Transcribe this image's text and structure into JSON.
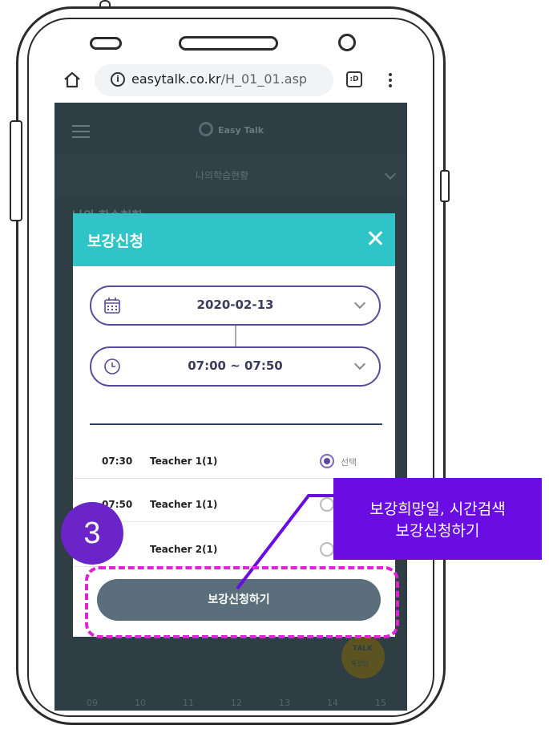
{
  "browser": {
    "url_host": "easytalk.co.kr",
    "url_path": "/H_01_01.asp",
    "tab_icon_label": ":D"
  },
  "web": {
    "logo_text": "Easy Talk",
    "nav_label": "나의학습현황",
    "section_title": "나의 학습현황",
    "talk_label_top": "TALK",
    "talk_label_bottom": "톡상담",
    "hours": [
      "09",
      "10",
      "11",
      "12",
      "13",
      "14",
      "15"
    ]
  },
  "modal": {
    "title": "보강신청",
    "date_value": "2020-02-13",
    "time_value": "07:00 ~ 07:50",
    "rows": [
      {
        "time": "07:30",
        "teacher": "Teacher 1(1)",
        "selected": true,
        "select_label": "선택"
      },
      {
        "time": "07:50",
        "teacher": "Teacher 1(1)",
        "selected": false,
        "select_label": ""
      },
      {
        "time": "30",
        "teacher": "Teacher 2(1)",
        "selected": false,
        "select_label": ""
      }
    ],
    "submit_label": "보강신청하기"
  },
  "annotation": {
    "step": "3",
    "callout_line1": "보강희망일, 시간검색",
    "callout_line2": "보강신청하기",
    "callout_color": "#6a0de2",
    "highlight_color": "#e021d6"
  },
  "colors": {
    "modal_header": "#2ec4c8",
    "field_border": "#5b4a9a",
    "submit_bg": "#5b6e7c"
  }
}
